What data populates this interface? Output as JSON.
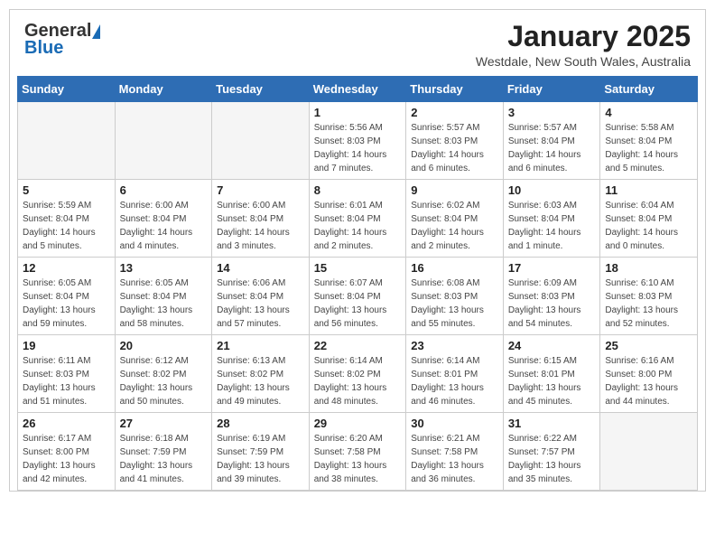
{
  "header": {
    "logo_general": "General",
    "logo_blue": "Blue",
    "month_title": "January 2025",
    "location": "Westdale, New South Wales, Australia"
  },
  "days_of_week": [
    "Sunday",
    "Monday",
    "Tuesday",
    "Wednesday",
    "Thursday",
    "Friday",
    "Saturday"
  ],
  "weeks": [
    [
      {
        "day": "",
        "info": ""
      },
      {
        "day": "",
        "info": ""
      },
      {
        "day": "",
        "info": ""
      },
      {
        "day": "1",
        "info": "Sunrise: 5:56 AM\nSunset: 8:03 PM\nDaylight: 14 hours\nand 7 minutes."
      },
      {
        "day": "2",
        "info": "Sunrise: 5:57 AM\nSunset: 8:03 PM\nDaylight: 14 hours\nand 6 minutes."
      },
      {
        "day": "3",
        "info": "Sunrise: 5:57 AM\nSunset: 8:04 PM\nDaylight: 14 hours\nand 6 minutes."
      },
      {
        "day": "4",
        "info": "Sunrise: 5:58 AM\nSunset: 8:04 PM\nDaylight: 14 hours\nand 5 minutes."
      }
    ],
    [
      {
        "day": "5",
        "info": "Sunrise: 5:59 AM\nSunset: 8:04 PM\nDaylight: 14 hours\nand 5 minutes."
      },
      {
        "day": "6",
        "info": "Sunrise: 6:00 AM\nSunset: 8:04 PM\nDaylight: 14 hours\nand 4 minutes."
      },
      {
        "day": "7",
        "info": "Sunrise: 6:00 AM\nSunset: 8:04 PM\nDaylight: 14 hours\nand 3 minutes."
      },
      {
        "day": "8",
        "info": "Sunrise: 6:01 AM\nSunset: 8:04 PM\nDaylight: 14 hours\nand 2 minutes."
      },
      {
        "day": "9",
        "info": "Sunrise: 6:02 AM\nSunset: 8:04 PM\nDaylight: 14 hours\nand 2 minutes."
      },
      {
        "day": "10",
        "info": "Sunrise: 6:03 AM\nSunset: 8:04 PM\nDaylight: 14 hours\nand 1 minute."
      },
      {
        "day": "11",
        "info": "Sunrise: 6:04 AM\nSunset: 8:04 PM\nDaylight: 14 hours\nand 0 minutes."
      }
    ],
    [
      {
        "day": "12",
        "info": "Sunrise: 6:05 AM\nSunset: 8:04 PM\nDaylight: 13 hours\nand 59 minutes."
      },
      {
        "day": "13",
        "info": "Sunrise: 6:05 AM\nSunset: 8:04 PM\nDaylight: 13 hours\nand 58 minutes."
      },
      {
        "day": "14",
        "info": "Sunrise: 6:06 AM\nSunset: 8:04 PM\nDaylight: 13 hours\nand 57 minutes."
      },
      {
        "day": "15",
        "info": "Sunrise: 6:07 AM\nSunset: 8:04 PM\nDaylight: 13 hours\nand 56 minutes."
      },
      {
        "day": "16",
        "info": "Sunrise: 6:08 AM\nSunset: 8:03 PM\nDaylight: 13 hours\nand 55 minutes."
      },
      {
        "day": "17",
        "info": "Sunrise: 6:09 AM\nSunset: 8:03 PM\nDaylight: 13 hours\nand 54 minutes."
      },
      {
        "day": "18",
        "info": "Sunrise: 6:10 AM\nSunset: 8:03 PM\nDaylight: 13 hours\nand 52 minutes."
      }
    ],
    [
      {
        "day": "19",
        "info": "Sunrise: 6:11 AM\nSunset: 8:03 PM\nDaylight: 13 hours\nand 51 minutes."
      },
      {
        "day": "20",
        "info": "Sunrise: 6:12 AM\nSunset: 8:02 PM\nDaylight: 13 hours\nand 50 minutes."
      },
      {
        "day": "21",
        "info": "Sunrise: 6:13 AM\nSunset: 8:02 PM\nDaylight: 13 hours\nand 49 minutes."
      },
      {
        "day": "22",
        "info": "Sunrise: 6:14 AM\nSunset: 8:02 PM\nDaylight: 13 hours\nand 48 minutes."
      },
      {
        "day": "23",
        "info": "Sunrise: 6:14 AM\nSunset: 8:01 PM\nDaylight: 13 hours\nand 46 minutes."
      },
      {
        "day": "24",
        "info": "Sunrise: 6:15 AM\nSunset: 8:01 PM\nDaylight: 13 hours\nand 45 minutes."
      },
      {
        "day": "25",
        "info": "Sunrise: 6:16 AM\nSunset: 8:00 PM\nDaylight: 13 hours\nand 44 minutes."
      }
    ],
    [
      {
        "day": "26",
        "info": "Sunrise: 6:17 AM\nSunset: 8:00 PM\nDaylight: 13 hours\nand 42 minutes."
      },
      {
        "day": "27",
        "info": "Sunrise: 6:18 AM\nSunset: 7:59 PM\nDaylight: 13 hours\nand 41 minutes."
      },
      {
        "day": "28",
        "info": "Sunrise: 6:19 AM\nSunset: 7:59 PM\nDaylight: 13 hours\nand 39 minutes."
      },
      {
        "day": "29",
        "info": "Sunrise: 6:20 AM\nSunset: 7:58 PM\nDaylight: 13 hours\nand 38 minutes."
      },
      {
        "day": "30",
        "info": "Sunrise: 6:21 AM\nSunset: 7:58 PM\nDaylight: 13 hours\nand 36 minutes."
      },
      {
        "day": "31",
        "info": "Sunrise: 6:22 AM\nSunset: 7:57 PM\nDaylight: 13 hours\nand 35 minutes."
      },
      {
        "day": "",
        "info": ""
      }
    ]
  ]
}
